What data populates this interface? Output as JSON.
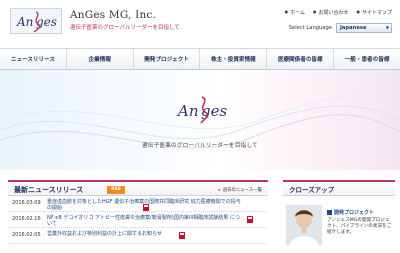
{
  "header": {
    "company": "AnGes MG, Inc.",
    "tagline": "遺伝子医薬のグローバルリーダーを目指して",
    "util_links": [
      "ホーム",
      "お問い合わせ",
      "サイトマップ"
    ],
    "language_label": "Select Language",
    "language_value": "Japanese"
  },
  "nav": {
    "items": [
      "ニュースリリース",
      "企業情報",
      "開発プロジェクト",
      "株主・投資家情報",
      "医療関係者の皆様",
      "一般・患者の皆様"
    ]
  },
  "hero": {
    "tagline": "遺伝子医薬のグローバルリーダーを目指して"
  },
  "news": {
    "title": "最新ニュースリリース",
    "rss": "RSS",
    "more": "過去のニュース一覧",
    "items": [
      {
        "date": "2016.03.09",
        "text": "重症虚血肢を対象としたHGF 遺伝子治療薬の国際共同臨床研究 協力医療機関での投与の開始"
      },
      {
        "date": "2016.02.16",
        "text": "NF-κB デコイオリゴ アトピー性皮膚炎治療薬(軟膏製剤)国内第III相臨床試験結果 について"
      },
      {
        "date": "2016.02.05",
        "text": "営業外収益および特別利益の計上に関するお知らせ"
      }
    ]
  },
  "closeup": {
    "title": "クローズアップ",
    "link": "開発プロジェクト",
    "desc": "アンジェスMGの開発プロジェクト、パイプラインの状況をご紹介します。"
  },
  "colors": {
    "brand_navy": "#1a2f55",
    "accent_magenta": "#c0306a",
    "link_blue": "#1a4a8a",
    "rss_orange": "#f28a1e"
  },
  "icons": [
    "anges-logo",
    "rss-icon",
    "pdf-icon",
    "bullet-icon",
    "chevron-down-icon"
  ]
}
